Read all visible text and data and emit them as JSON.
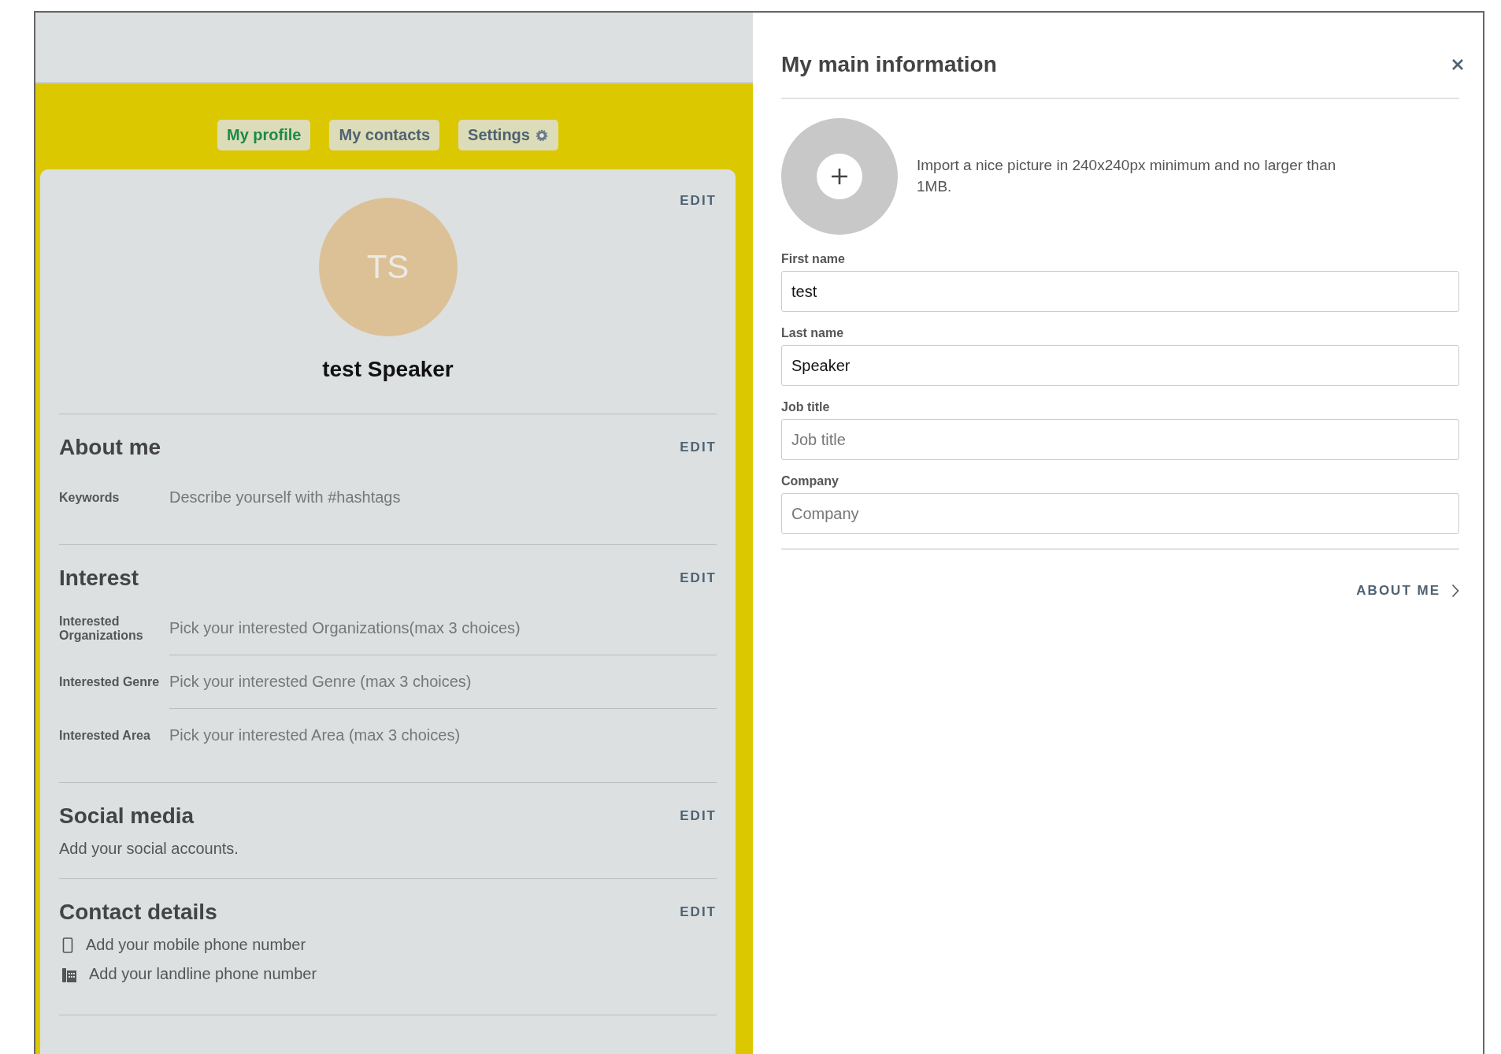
{
  "tabs": [
    {
      "label": "My profile",
      "selected": true,
      "kind": "plain"
    },
    {
      "label": "My contacts",
      "selected": false,
      "kind": "plain"
    },
    {
      "label": "Settings",
      "selected": false,
      "kind": "gear"
    }
  ],
  "profile": {
    "edit": "EDIT",
    "initials": "TS",
    "name": "test Speaker"
  },
  "sections": [
    {
      "kind": "fields",
      "title": "About me",
      "edit": "EDIT",
      "rows": [
        {
          "label": "Keywords",
          "value": "Describe yourself with #hashtags"
        }
      ]
    },
    {
      "kind": "fields",
      "title": "Interest",
      "edit": "EDIT",
      "rows": [
        {
          "label": "Interested Organizations",
          "value": "Pick your interested Organizations(max 3 choices)"
        },
        {
          "label": "Interested Genre",
          "value": "Pick your interested Genre (max 3 choices)"
        },
        {
          "label": "Interested Area",
          "value": "Pick your interested Area (max 3 choices)"
        }
      ]
    },
    {
      "kind": "text",
      "title": "Social media",
      "edit": "EDIT",
      "text": "Add your social accounts."
    },
    {
      "kind": "contacts",
      "title": "Contact details",
      "edit": "EDIT",
      "items": [
        {
          "kind": "mobile",
          "text": "Add your mobile phone number"
        },
        {
          "kind": "landline",
          "text": "Add your landline phone number"
        }
      ]
    }
  ],
  "panel": {
    "title": "My main information",
    "upload_hint": "Import a nice picture in 240x240px minimum and no larger than 1MB.",
    "fields": [
      {
        "label": "First name",
        "value": "test"
      },
      {
        "label": "Last name",
        "value": "Speaker"
      },
      {
        "label": "Job title",
        "placeholder": "Job title"
      },
      {
        "label": "Company",
        "placeholder": "Company"
      }
    ],
    "next": "ABOUT ME"
  }
}
